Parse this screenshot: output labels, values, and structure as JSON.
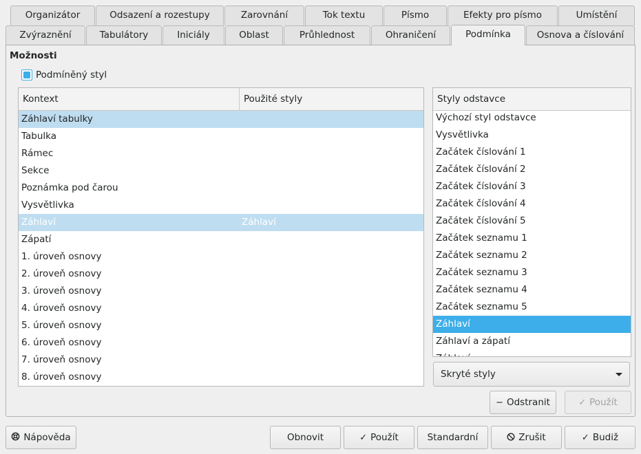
{
  "tabs_row1": [
    "Organizátor",
    "Odsazení a rozestupy",
    "Zarovnání",
    "Tok textu",
    "Písmo",
    "Efekty pro písmo",
    "Umístění"
  ],
  "tabs_row2": [
    "Zvýraznění",
    "Tabulátory",
    "Iniciály",
    "Oblast",
    "Průhlednost",
    "Ohraničení",
    "Podmínka",
    "Osnova a číslování"
  ],
  "active_tab": "Podmínka",
  "options": {
    "title": "Možnosti",
    "conditional_style_label": "Podmíněný styl",
    "conditional_style_checked": true
  },
  "context_table": {
    "headers": [
      "Kontext",
      "Použité styly"
    ],
    "rows": [
      {
        "context": "Záhlaví tabulky",
        "style": ""
      },
      {
        "context": "Tabulka",
        "style": ""
      },
      {
        "context": "Rámec",
        "style": ""
      },
      {
        "context": "Sekce",
        "style": ""
      },
      {
        "context": "Poznámka pod čarou",
        "style": ""
      },
      {
        "context": "Vysvětlivka",
        "style": ""
      },
      {
        "context": "Záhlaví",
        "style": "Záhlaví"
      },
      {
        "context": "Zápatí",
        "style": ""
      },
      {
        "context": " 1. úroveň osnovy",
        "style": ""
      },
      {
        "context": " 2. úroveň osnovy",
        "style": ""
      },
      {
        "context": " 3. úroveň osnovy",
        "style": ""
      },
      {
        "context": " 4. úroveň osnovy",
        "style": ""
      },
      {
        "context": " 5. úroveň osnovy",
        "style": ""
      },
      {
        "context": " 6. úroveň osnovy",
        "style": ""
      },
      {
        "context": " 7. úroveň osnovy",
        "style": ""
      },
      {
        "context": " 8. úroveň osnovy",
        "style": ""
      }
    ]
  },
  "paragraph_styles": {
    "header": "Styly odstavce",
    "items": [
      "Výchozí styl odstavce",
      "Vysvětlivka",
      "Začátek číslování 1",
      "Začátek číslování 2",
      "Začátek číslování 3",
      "Začátek číslování 4",
      "Začátek číslování 5",
      "Začátek seznamu 1",
      "Začátek seznamu 2",
      "Začátek seznamu 3",
      "Začátek seznamu 4",
      "Začátek seznamu 5",
      "Záhlaví",
      "Záhlaví a zápatí",
      "Záhlaví..."
    ],
    "selected": "Záhlaví"
  },
  "filter_combo": {
    "value": "Skryté styly"
  },
  "buttons": {
    "remove": "Odstranit",
    "apply_condition": "Použít",
    "help": "Nápověda",
    "reset": "Obnovit",
    "apply": "Použít",
    "standard": "Standardní",
    "cancel": "Zrušit",
    "ok": "Budiž"
  },
  "icons": {
    "remove": "minus-icon",
    "apply_condition": "check-icon",
    "help": "lifebuoy-icon",
    "apply": "check-icon",
    "cancel": "cancel-circle-icon",
    "ok": "check-icon"
  },
  "colors": {
    "accent": "#3daee9",
    "selection_light": "#bfddf0"
  }
}
